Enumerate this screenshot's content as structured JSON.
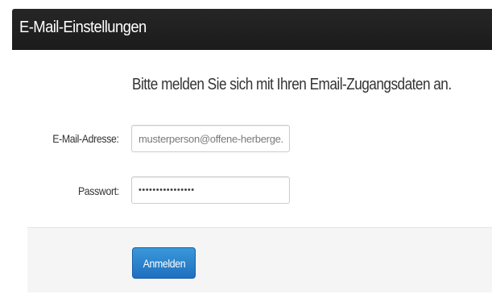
{
  "header": {
    "title": "E-Mail-Einstellungen"
  },
  "form": {
    "intro": "Bitte melden Sie sich mit Ihren Email-Zugangsdaten an.",
    "email_label": "E-Mail-Adresse:",
    "email_placeholder": "musterperson@offene-herberge.de",
    "email_value": "",
    "password_label": "Passwort:",
    "password_value": "••••••••••••••••",
    "submit_label": "Anmelden"
  },
  "colors": {
    "header_bg": "#1b1b1b",
    "button_bg": "#2a82cc",
    "footer_bg": "#f5f5f5"
  }
}
